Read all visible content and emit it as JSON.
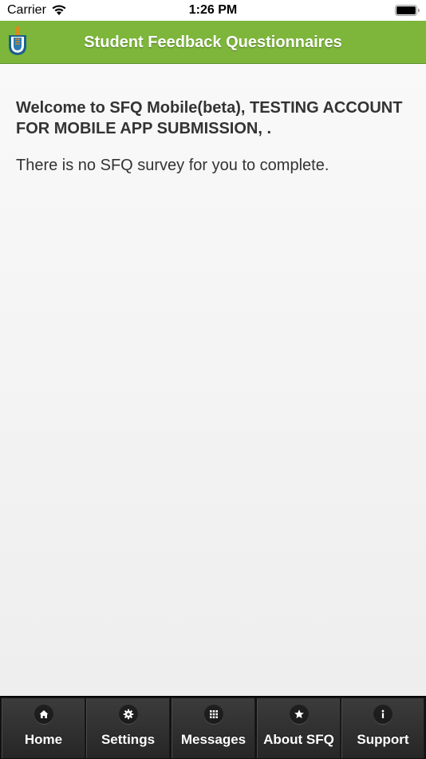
{
  "status_bar": {
    "carrier": "Carrier",
    "time": "1:26 PM"
  },
  "header": {
    "title": "Student Feedback Questionnaires",
    "brand_color": "#7db63b"
  },
  "main": {
    "welcome": "Welcome to SFQ Mobile(beta), TESTING ACCOUNT FOR MOBILE APP SUBMISSION, .",
    "message": "There is no SFQ survey for you to complete."
  },
  "tabs": [
    {
      "label": "Home",
      "icon": "home-icon"
    },
    {
      "label": "Settings",
      "icon": "gear-icon"
    },
    {
      "label": "Messages",
      "icon": "grid-icon"
    },
    {
      "label": "About SFQ",
      "icon": "star-icon"
    },
    {
      "label": "Support",
      "icon": "info-icon"
    }
  ]
}
